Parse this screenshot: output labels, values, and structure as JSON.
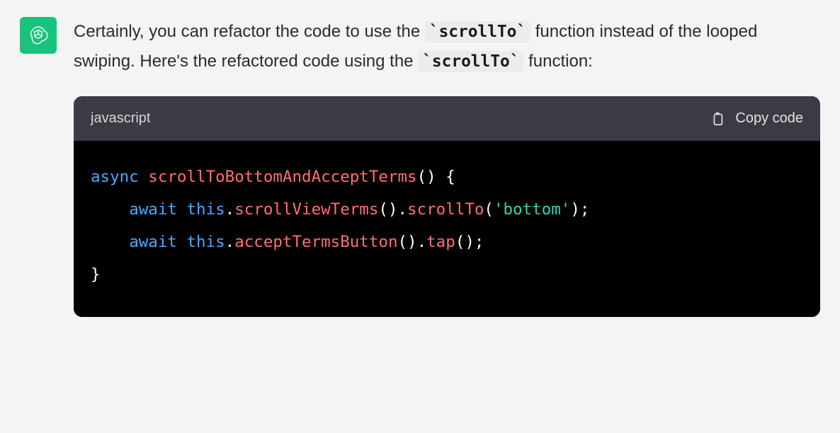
{
  "avatar": {
    "name": "assistant-logo"
  },
  "message": {
    "intro_parts": [
      "Certainly, you can refactor the code to use the ",
      " function instead of the looped swiping. Here's the refactored code using the ",
      " function:"
    ],
    "code_inline_1": "`scrollTo`",
    "code_inline_2": "`scrollTo`"
  },
  "code_block": {
    "language": "javascript",
    "copy_label": "Copy code",
    "tokens": {
      "kw_async": "async",
      "fn_name": "scrollToBottomAndAcceptTerms",
      "paren_open": "()",
      "brace_open": " {",
      "kw_await": "await",
      "this": "this",
      "dot": ".",
      "m_scrollViewTerms": "scrollViewTerms",
      "m_scrollTo": "scrollTo",
      "str_bottom": "'bottom'",
      "m_acceptTermsButton": "acceptTermsButton",
      "m_tap": "tap",
      "call_empty": "()",
      "semi": ";",
      "brace_close": "}"
    }
  }
}
